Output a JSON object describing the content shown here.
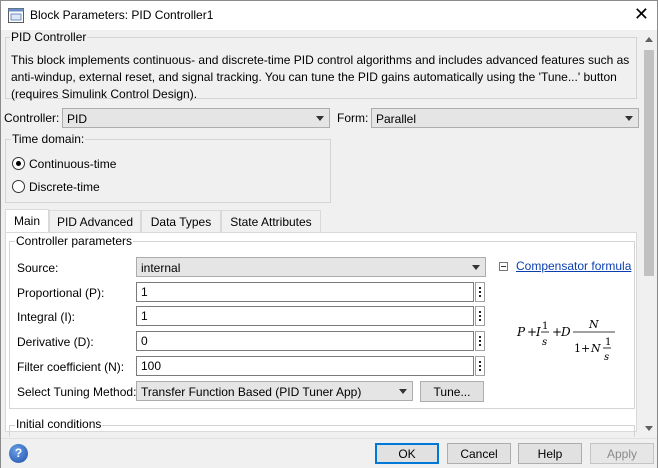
{
  "window": {
    "title": "Block Parameters: PID Controller1",
    "close_glyph": "✕"
  },
  "header": {
    "group_title": "PID Controller",
    "description": "This block implements continuous- and discrete-time PID control algorithms and includes advanced features such as anti-windup, external reset, and signal tracking. You can tune the PID gains automatically using the 'Tune...' button (requires Simulink Control Design)."
  },
  "controller": {
    "label": "Controller:",
    "value": "PID"
  },
  "form": {
    "label": "Form:",
    "value": "Parallel"
  },
  "time_domain": {
    "title": "Time domain:",
    "options": [
      {
        "label": "Continuous-time",
        "selected": true
      },
      {
        "label": "Discrete-time",
        "selected": false
      }
    ]
  },
  "tabs": [
    {
      "label": "Main",
      "active": true
    },
    {
      "label": "PID Advanced",
      "active": false
    },
    {
      "label": "Data Types",
      "active": false
    },
    {
      "label": "State Attributes",
      "active": false
    }
  ],
  "controller_params": {
    "title": "Controller parameters",
    "source": {
      "label": "Source:",
      "value": "internal"
    },
    "proportional": {
      "label": "Proportional (P):",
      "value": "1"
    },
    "integral": {
      "label": "Integral (I):",
      "value": "1"
    },
    "derivative": {
      "label": "Derivative (D):",
      "value": "0"
    },
    "filter": {
      "label": "Filter coefficient (N):",
      "value": "100"
    },
    "tuning": {
      "label": "Select Tuning Method:",
      "value": "Transfer Function Based (PID Tuner App)",
      "tune_label": "Tune..."
    },
    "compensator_link": "Compensator formula"
  },
  "formula": {
    "P": "P",
    "plus": "+",
    "I": "I",
    "D": "D",
    "N": "N",
    "one": "1",
    "s": "s",
    "denom_one_plus": "1+"
  },
  "initial_conditions": {
    "title": "Initial conditions"
  },
  "buttons": {
    "help_glyph": "?",
    "ok": "OK",
    "cancel": "Cancel",
    "help": "Help",
    "apply": "Apply"
  },
  "colors": {
    "link": "#0b3fb0",
    "primary_border": "#0078d7",
    "disabled_text": "#8a8a8a"
  }
}
